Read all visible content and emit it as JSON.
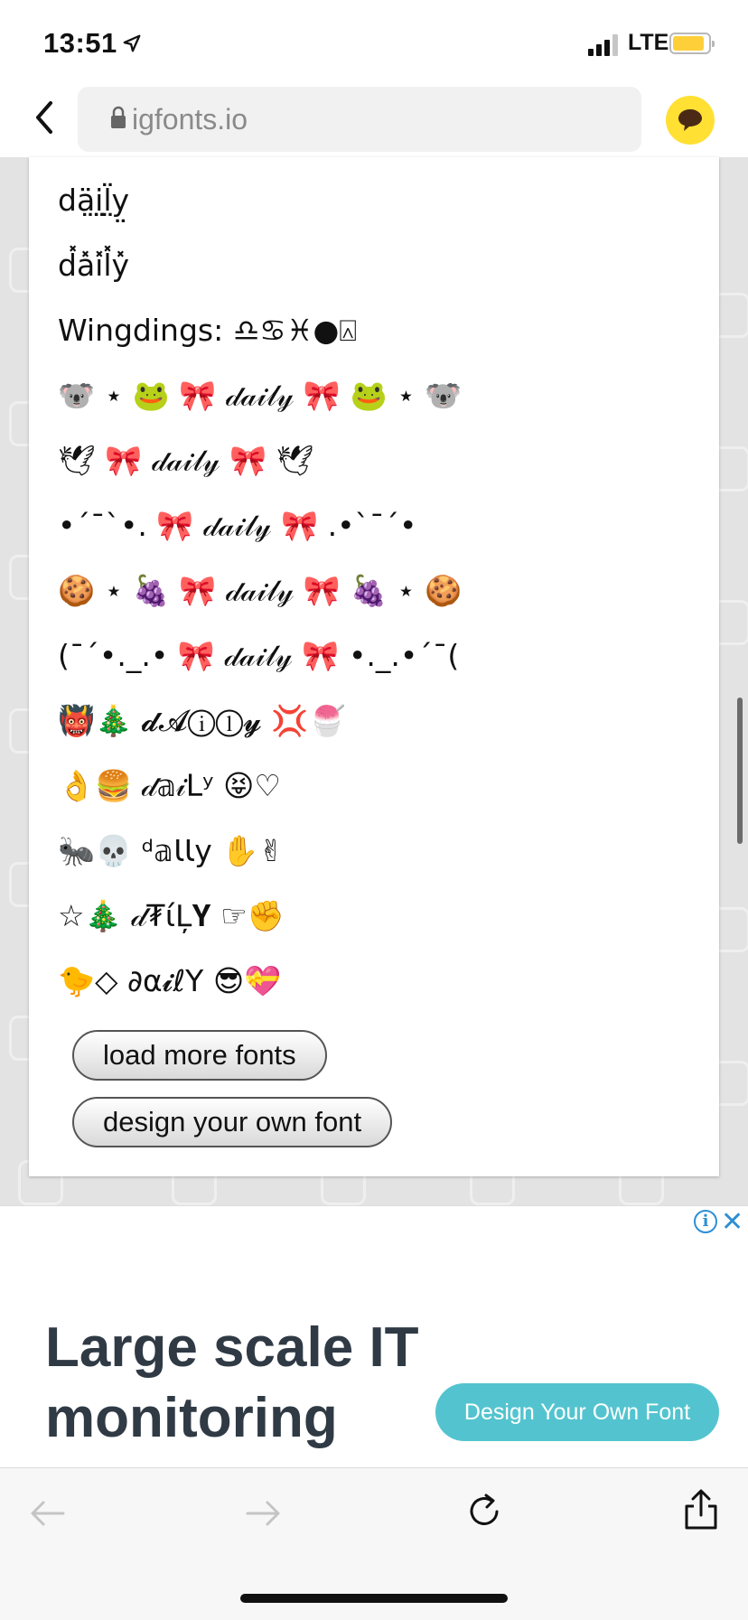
{
  "status": {
    "time": "13:51",
    "carrier": "LTE"
  },
  "browser": {
    "url": "igfonts.io"
  },
  "fonts": [
    "dӓ̤i̤̤l̤̈y̤",
    "d̽a̽i̽l̽y̽",
    "Wingdings: ♎︎♋︎♓︎●︎⍓︎",
    "🐨 ⋆ 🐸  🎀  𝒹𝒶𝒾𝓁𝓎  🎀  🐸 ⋆ 🐨",
    "🕊  🎀  𝒹𝒶𝒾𝓁𝓎  🎀  🕊",
    "•´¯`•.  🎀  𝒹𝒶𝒾𝓁𝓎  🎀  .•`¯´•",
    "🍪 ⋆ 🍇  🎀  𝒹𝒶𝒾𝓁𝓎  🎀  🍇 ⋆ 🍪",
    "(¯´•._.•  🎀  𝒹𝒶𝒾𝓁𝓎  🎀  •._.•´¯(",
    "👹🎄  𝓭𝓐ⓘⓛ𝔂  💢🍧",
    "👌🍔  𝒹𝕒𝒾ᒪʸ  😝♡",
    "🐜💀  ᵈ𝕒ƖƖy  ✋✌",
    "☆🎄  𝒹₮ίĻ𝐘  ☞✊",
    "🐤◇  ∂α𝓲ℓY  😎💝"
  ],
  "buttons": {
    "load_more": "load more fonts",
    "design_own": "design your own font"
  },
  "ad": {
    "headline": "Large scale IT monitoring",
    "cta": "Design Your Own Font",
    "info": "i",
    "close": "✕"
  },
  "colors": {
    "accent_yellow": "#ffe033",
    "ad_cta": "#53c4cf",
    "ad_text": "#2f3a45",
    "ad_info": "#2d8fd5"
  }
}
